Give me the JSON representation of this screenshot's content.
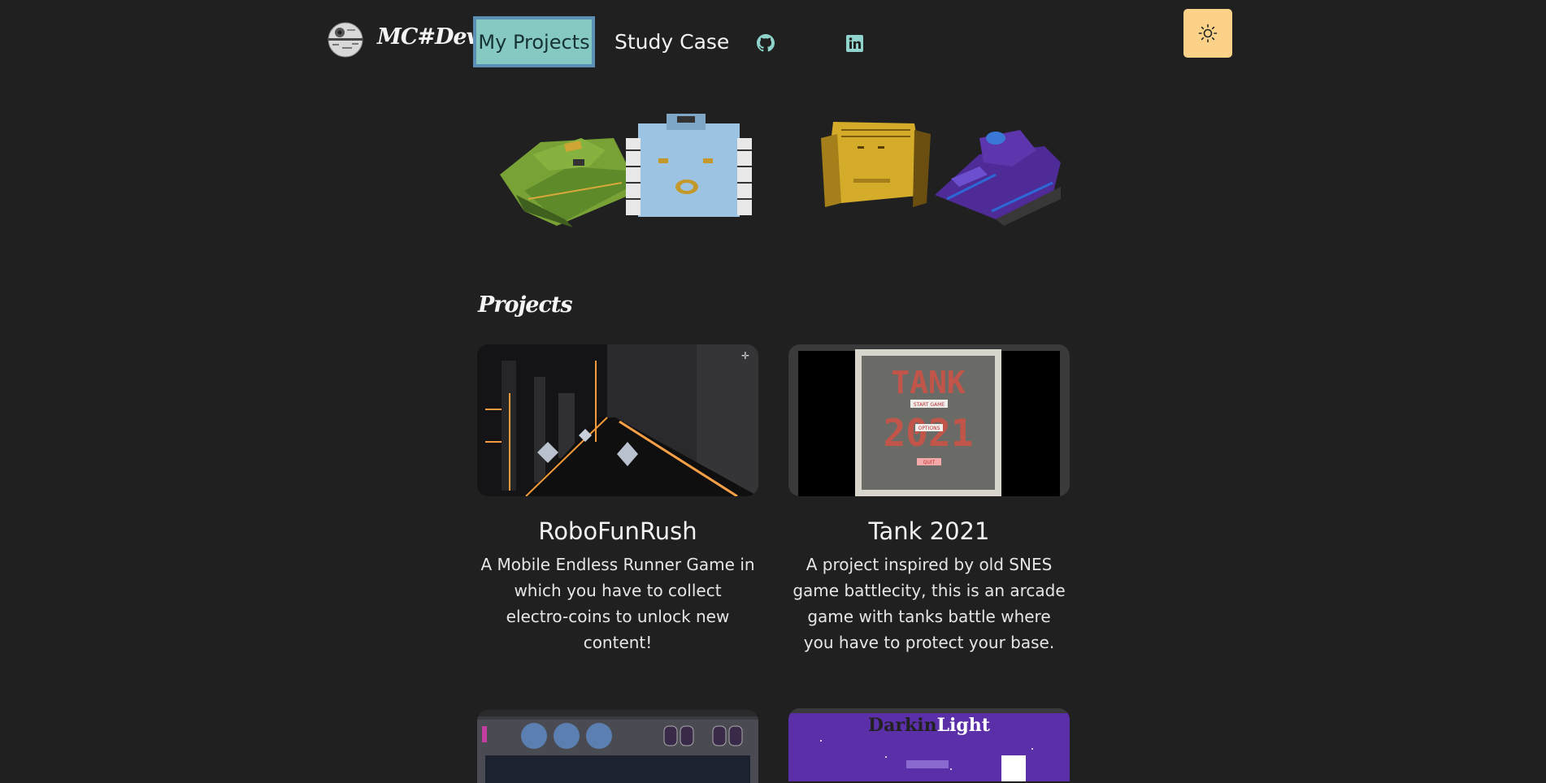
{
  "brand": {
    "name": "MC#Dev"
  },
  "nav": {
    "items": [
      {
        "label": "My Projects"
      },
      {
        "label": "Study Case"
      }
    ],
    "icons": {
      "github": "github-icon",
      "linkedin": "linkedin-icon",
      "theme": "sun-icon"
    }
  },
  "section": {
    "title": "Projects"
  },
  "projects": [
    {
      "title": "RoboFunRush",
      "description": "A Mobile Endless Runner Game in which you have to collect electro-coins to unlock new content!"
    },
    {
      "title": "Tank 2021",
      "description": "A project inspired by old SNES game battlecity, this is an arcade game with tanks battle where you have to protect your base.",
      "thumb_text": {
        "title": "TANK",
        "year": "2021",
        "start": "START GAME",
        "options": "OPTIONS",
        "quit": "QUIT"
      }
    },
    {
      "title": "",
      "description": ""
    },
    {
      "title": "",
      "description": "",
      "thumb_text": {
        "title_dark": "Darkin",
        "title_light": "Light"
      }
    }
  ],
  "colors": {
    "accent": "#86c9c3",
    "accent_border": "#5b8fb5",
    "theme_button": "#fcd289",
    "background": "#202020"
  }
}
